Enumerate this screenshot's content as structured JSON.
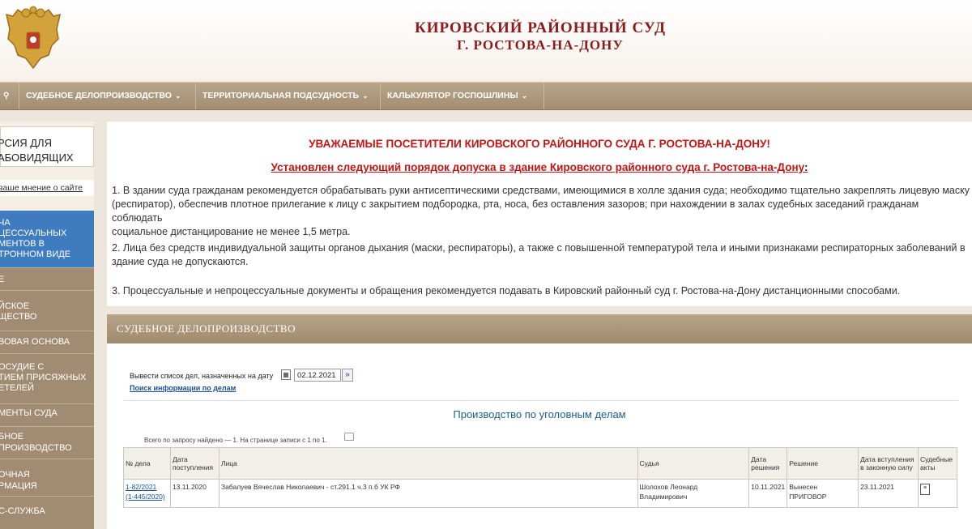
{
  "header": {
    "title_line1": "КИРОВСКИЙ РАЙОННЫЙ СУД",
    "title_line2": "Г. РОСТОВА-НА-ДОНУ"
  },
  "nav": {
    "search_icon": "search-icon",
    "items": [
      {
        "label": "СУДЕБНОЕ ДЕЛОПРОИЗВОДСТВО"
      },
      {
        "label": "ТЕРРИТОРИАЛЬНАЯ ПОДСУДНОСТЬ"
      },
      {
        "label": "КАЛЬКУЛЯТОР ГОСПОШЛИНЫ"
      }
    ]
  },
  "sidebar": {
    "blind_line1": "РСИЯ ДЛЯ",
    "blind_line2": "АБОВИДЯЩИХ",
    "opinion": "ваше мнение о сайте",
    "blue_lines": [
      "ЧА",
      "ЦЕССУАЛЬНЫХ",
      "МЕНТОВ В",
      "ТРОННОМ ВИДЕ"
    ],
    "items": [
      {
        "lines": [
          "Е"
        ]
      },
      {
        "lines": [
          "ЙСКОЕ",
          "ЩЕСТВО"
        ]
      },
      {
        "lines": [
          "ВОВАЯ ОСНОВА"
        ]
      },
      {
        "lines": [
          "ОСУДИЕ С",
          "ТИЕМ ПРИСЯЖНЫХ",
          "ЕТЕЛЕЙ"
        ]
      },
      {
        "lines": [
          "МЕНТЫ СУДА"
        ]
      },
      {
        "lines": [
          "БНОЕ",
          "ПРОИЗВОДСТВО"
        ]
      },
      {
        "lines": [
          "ОЧНАЯ",
          "РМАЦИЯ"
        ]
      },
      {
        "lines": [
          "С-СЛУЖБА"
        ]
      }
    ]
  },
  "notice": {
    "heading": "УВАЖАЕМЫЕ ПОСЕТИТЕЛИ КИРОВСКОГО РАЙОННОГО СУДА Г. РОСТОВА-НА-ДОНУ!",
    "subheading": "Установлен следующий порядок допуска в здание Кировского районного суда г. Ростова-на-Дону",
    "subheading_colon": ":",
    "p1_line1": "1. В здании суда гражданам рекомендуется обрабатывать руки антисептическими средствами, имеющимися в холле здания суда; необходимо тщательно закреплять лицевую маску",
    "p1_line2": "(респиратор), обеспечив плотное прилегание к лицу с закрытием подбородка, рта, носа, без оставления зазоров; при нахождении в залах судебных заседаний гражданам соблюдать",
    "p1_line3": "социальное дистанцирование не менее 1,5 метра.",
    "p2_line1": "2. Лица без средств индивидуальной защиты органов дыхания (маски, респираторы), а также с повышенной температурой тела и иными признаками респираторных заболеваний в",
    "p2_line2": "здание суда не допускаются.",
    "p3": "3. Процессуальные и непроцессуальные документы и обращения рекомендуется подавать в Кировский районный суд г. Ростова-на-Дону дистанционными способами."
  },
  "section": {
    "title": "СУДЕБНОЕ ДЕЛОПРОИЗВОДСТВО",
    "date_label": "Вывести список дел, назначенных на дату",
    "date_value": "02.12.2021",
    "go_glyph": "»",
    "search_link": "Поиск информации по делам",
    "prod_title": "Производство по уголовным делам",
    "found_text": "Всего по запросу найдено — 1. На странице записи с 1 по 1.",
    "table": {
      "headers": [
        "№ дела",
        "Дата поступления",
        "Лица",
        "Судья",
        "Дата решения",
        "Решение",
        "Дата вступления в законную силу",
        "Судебные акты"
      ],
      "rows": [
        {
          "case_no": "1-82/2021",
          "case_no2": "(1-445/2020)",
          "received": "13.11.2020",
          "persons": "Забалуев Вячеслав Николаевич - ст.291.1 ч.3 п.б УК РФ",
          "judge": "Шолохов Леонард Владимирович",
          "decision_date": "10.11.2021",
          "decision": "Вынесен ПРИГОВОР",
          "effective_date": "23.11.2021",
          "acts_icon": "document-icon"
        }
      ]
    }
  }
}
